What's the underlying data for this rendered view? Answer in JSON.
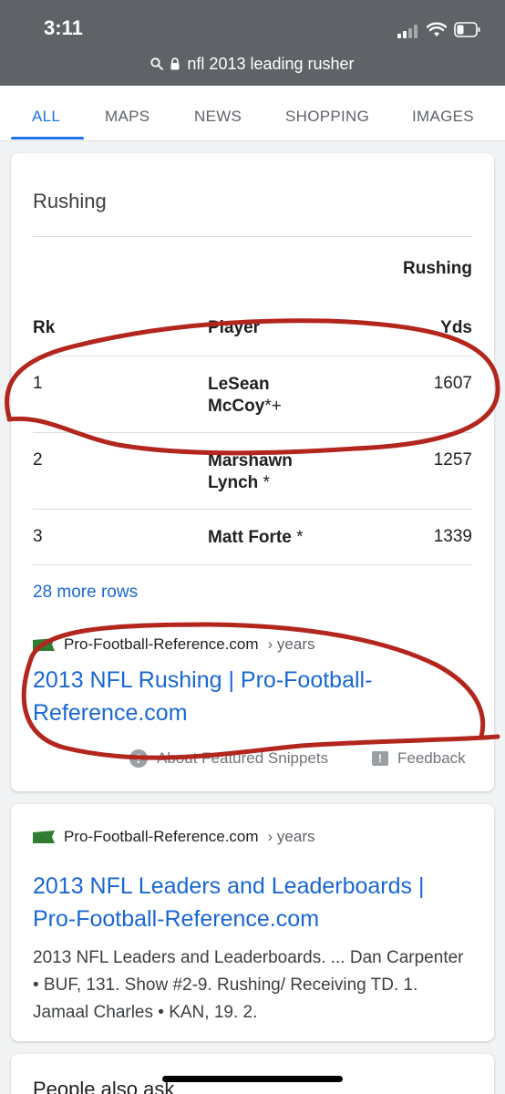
{
  "status_bar": {
    "time": "3:11",
    "url": "nfl 2013 leading rusher"
  },
  "tabs": [
    {
      "label": "ALL",
      "active": true
    },
    {
      "label": "MAPS"
    },
    {
      "label": "NEWS"
    },
    {
      "label": "SHOPPING"
    },
    {
      "label": "IMAGES"
    }
  ],
  "featured": {
    "section_title": "Rushing",
    "table": {
      "headers": {
        "rk": "Rk",
        "player": "Player",
        "yds_top": "Rushing",
        "yds": "Yds"
      },
      "rows": [
        {
          "rk": "1",
          "player_line1": "LeSean",
          "player_line2": "McCoy",
          "mark": "*+",
          "yds": "1607"
        },
        {
          "rk": "2",
          "player_line1": "Marshawn",
          "player_line2": "Lynch",
          "mark": " *",
          "yds": "1257"
        },
        {
          "rk": "3",
          "player_line1": "Matt Forte",
          "player_line2": "",
          "mark": " *",
          "yds": "1339"
        }
      ]
    },
    "more_rows": "28 more rows",
    "source": "Pro-Football-Reference.com",
    "source_path": "› years",
    "link_line1": "2013 NFL Rushing | Pro-Football-",
    "link_line2": "Reference.com",
    "about": "About Featured Snippets",
    "feedback": "Feedback"
  },
  "result2": {
    "source": "Pro-Football-Reference.com",
    "source_path": "› years",
    "link_line1": "2013 NFL Leaders and Leaderboards |",
    "link_line2": "Pro-Football-Reference.com",
    "snippet": "2013 NFL Leaders and Leaderboards. ... Dan Carpenter • BUF, 131. Show #2-9. Rushing/ Receiving TD. 1. Jamaal Charles • KAN, 19. 2."
  },
  "people_also_ask": "People also ask",
  "colors": {
    "link": "#1967d2",
    "tab_active": "#1a73e8",
    "annotation": "#b3261e",
    "favicon": "#2e7d32"
  },
  "icons": [
    "signal-icon",
    "wifi-icon",
    "battery-icon",
    "search-icon",
    "lock-icon",
    "favicon-flag-icon",
    "help-icon",
    "feedback-icon"
  ]
}
